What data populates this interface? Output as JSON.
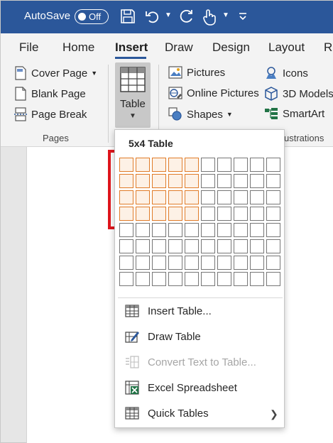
{
  "titlebar": {
    "autosave_label": "AutoSave",
    "toggle_state": "Off",
    "icons": [
      "save-icon",
      "undo-icon",
      "redo-icon",
      "touch-mode-icon",
      "customize-qat-icon"
    ],
    "accent_color": "#2b579a"
  },
  "tabs": [
    "File",
    "Home",
    "Insert",
    "Draw",
    "Design",
    "Layout",
    "R"
  ],
  "active_tab": "Insert",
  "ribbon": {
    "pages": {
      "cover_page": "Cover Page",
      "blank_page": "Blank Page",
      "page_break": "Page Break",
      "group_label": "Pages"
    },
    "table": {
      "label": "Table"
    },
    "illustrations": {
      "pictures": "Pictures",
      "online_pictures": "Online Pictures",
      "shapes": "Shapes",
      "icons": "Icons",
      "models_3d": "3D Models",
      "smartart": "SmartArt",
      "group_label": "ustrations"
    }
  },
  "table_menu": {
    "title": "5x4 Table",
    "grid": {
      "columns": 10,
      "rows": 8,
      "selected_columns": 5,
      "selected_rows": 4
    },
    "items": [
      {
        "label": "Insert Table...",
        "icon": "insert-table-icon",
        "enabled": true
      },
      {
        "label": "Draw Table",
        "icon": "draw-table-icon",
        "enabled": true
      },
      {
        "label": "Convert Text to Table...",
        "icon": "convert-text-to-table-icon",
        "enabled": false
      },
      {
        "label": "Excel Spreadsheet",
        "icon": "excel-spreadsheet-icon",
        "enabled": true
      },
      {
        "label": "Quick Tables",
        "icon": "quick-tables-icon",
        "enabled": true,
        "submenu": true
      }
    ]
  },
  "colors": {
    "selection_cell": "#e07b28",
    "highlight_box": "#e0161d",
    "excel_green": "#217346"
  }
}
